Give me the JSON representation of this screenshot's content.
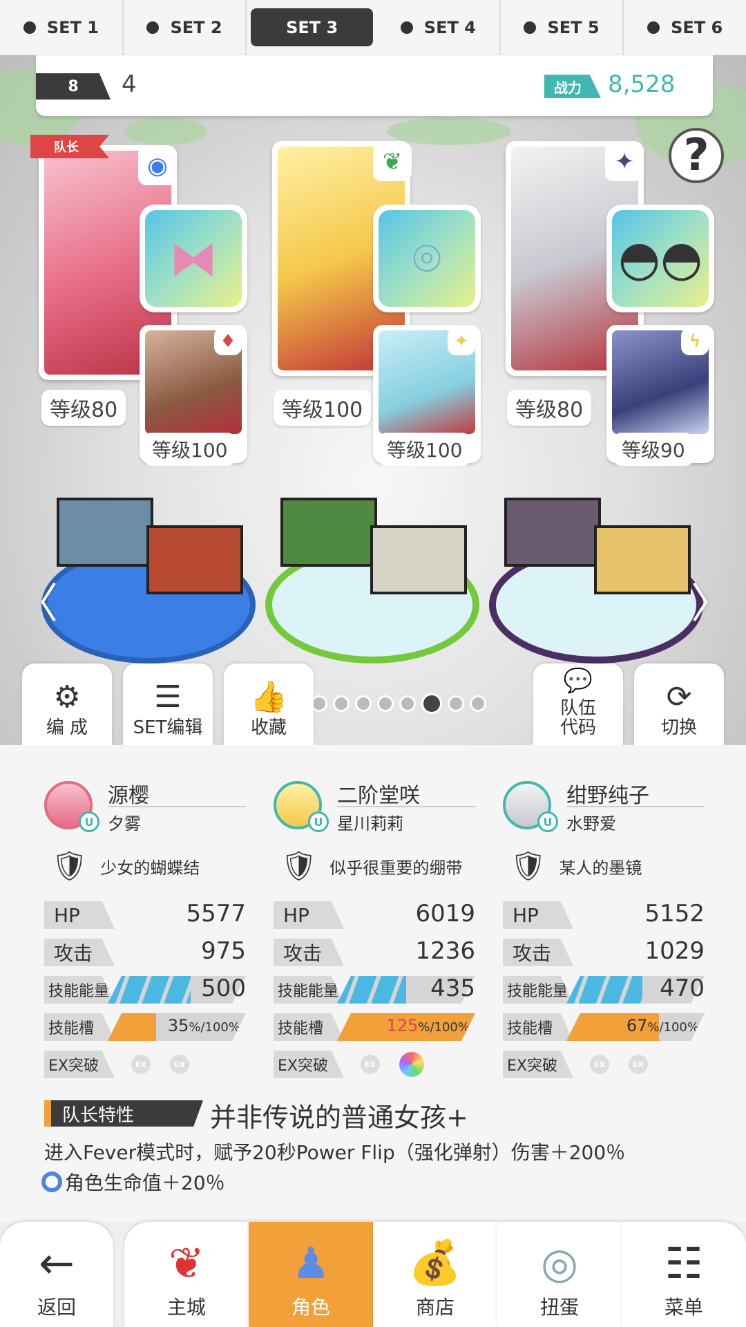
{
  "set_tabs": [
    "SET 1",
    "SET 2",
    "SET 3",
    "SET 4",
    "SET 5",
    "SET 6"
  ],
  "active_set": "SET 3",
  "team": {
    "number": "8",
    "count": "4",
    "power_label": "战力",
    "power_value": "8,528"
  },
  "help_label": "?",
  "leader_tag": "队长",
  "levels": {
    "c1_main": "等级80",
    "c1_sub": "等级100",
    "c2_main": "等级100",
    "c2_sub": "等级100",
    "c3_main": "等级80",
    "c3_sub": "等级90"
  },
  "toolbar": {
    "formation": "编 成",
    "set_edit": "SET编辑",
    "favorite": "收藏",
    "team_code": "队伍\n代码",
    "switch": "切换"
  },
  "page_dots": {
    "count": 10,
    "active": 8
  },
  "characters": [
    {
      "name": "源樱",
      "voice": "夕雾",
      "item": "少女的蝴蝶结",
      "hp_label": "HP",
      "hp": "5577",
      "atk_label": "攻击",
      "atk": "975",
      "energy_label": "技能能量",
      "energy": "500",
      "energy_fill": 0.6,
      "slot_label": "技能槽",
      "slot_value": "35",
      "slot_unit": "%/100%",
      "slot_fill": 0.35,
      "ex_label": "EX突破",
      "ex1": "EX",
      "ex2": "EX"
    },
    {
      "name": "二阶堂咲",
      "voice": "星川莉莉",
      "item": "似乎很重要的绷带",
      "hp_label": "HP",
      "hp": "6019",
      "atk_label": "攻击",
      "atk": "1236",
      "energy_label": "技能能量",
      "energy": "435",
      "energy_fill": 0.5,
      "slot_label": "技能槽",
      "slot_value": "125",
      "slot_unit": "%/100%",
      "slot_fill": 1.0,
      "ex_label": "EX突破",
      "ex1": "EX",
      "ex2": ""
    },
    {
      "name": "绀野纯子",
      "voice": "水野爱",
      "item": "某人的墨镜",
      "hp_label": "HP",
      "hp": "5152",
      "atk_label": "攻击",
      "atk": "1029",
      "energy_label": "技能能量",
      "energy": "470",
      "energy_fill": 0.55,
      "slot_label": "技能槽",
      "slot_value": "67",
      "slot_unit": "%/100%",
      "slot_fill": 0.67,
      "ex_label": "EX突破",
      "ex1": "EX",
      "ex2": "EX"
    }
  ],
  "leader_skill": {
    "label": "队长特性",
    "name": "并非传说的普通女孩+",
    "desc1": "进入Fever模式时，赋予20秒Power Flip（强化弹射）伤害＋200％",
    "desc2": "角色生命值＋20％"
  },
  "bottom_nav": [
    "返回",
    "主城",
    "角色",
    "商店",
    "扭蛋",
    "菜单"
  ],
  "active_nav": "角色",
  "colors": {
    "accent": "#f2a03a",
    "teal": "#3fb8b0",
    "dark": "#3b3b3b",
    "leader_red": "#e04545"
  }
}
